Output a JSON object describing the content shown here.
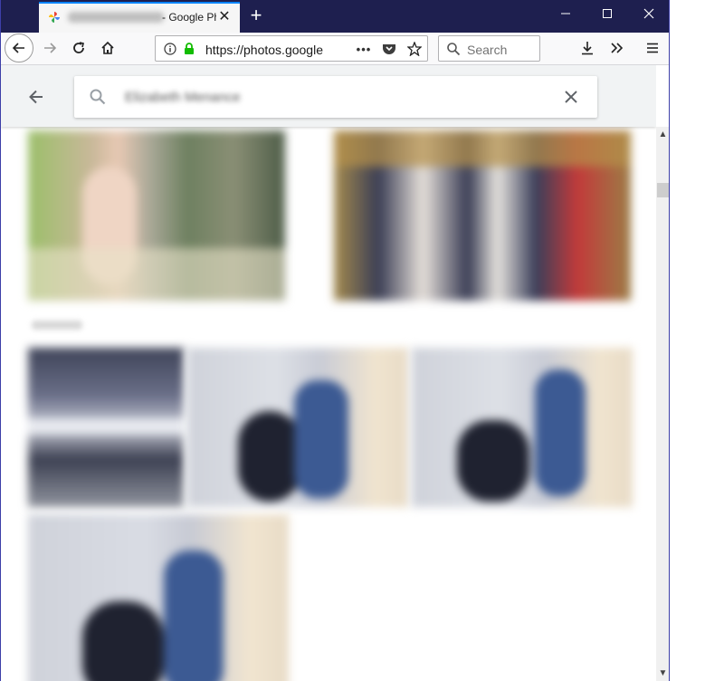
{
  "browser": {
    "tab": {
      "title": "- Google Ph",
      "favicon": "google-photos-pinwheel-icon"
    },
    "new_tab_icon": "plus-icon",
    "window_controls": [
      "minimize-icon",
      "maximize-icon",
      "close-icon"
    ],
    "url": "https://photos.google",
    "search_placeholder": "Search",
    "toolbar_icons": [
      "back-icon",
      "forward-icon",
      "reload-icon",
      "home-icon",
      "info-icon",
      "lock-icon",
      "more-icon",
      "pocket-icon",
      "bookmark-star-icon",
      "download-icon",
      "overflow-chevrons-icon",
      "menu-icon"
    ]
  },
  "photos_app": {
    "search_query": "Elizabeth Menance",
    "back_icon": "arrow-back-icon",
    "clear_icon": "clear-x-icon"
  },
  "colors": {
    "titlebar": "#1e1f4f",
    "tab_accent": "#0a84ff",
    "lock_green": "#12bc00",
    "app_header": "#f1f3f4"
  }
}
